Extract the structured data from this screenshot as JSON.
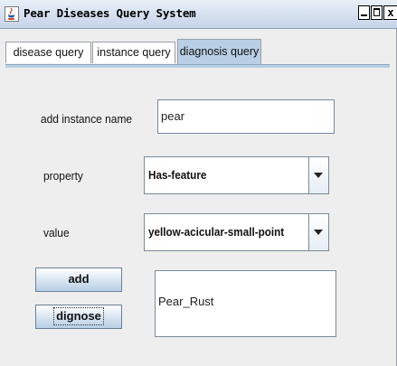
{
  "window": {
    "title": "Pear Diseases Query System",
    "buttons": {
      "minimize": "_",
      "maximize": "□",
      "close": "x"
    }
  },
  "tabs": [
    {
      "label": "disease query",
      "selected": false
    },
    {
      "label": "instance query",
      "selected": false
    },
    {
      "label": "diagnosis query",
      "selected": true
    }
  ],
  "form": {
    "instance_name_label": "add instance name",
    "instance_name_value": "pear",
    "property_label": "property",
    "property_value": "Has-feature",
    "value_label": "value",
    "value_value": "yellow-acicular-small-point",
    "add_button": "add",
    "diagnose_button": "dignose",
    "result_value": "Pear_Rust"
  },
  "colors": {
    "selected_tab": "#b8cfe5",
    "window_bg": "#eeeeee",
    "titlebar": "#c6d4e8"
  },
  "icons": {
    "app": "java-cup-icon",
    "dropdown": "chevron-down-icon"
  }
}
